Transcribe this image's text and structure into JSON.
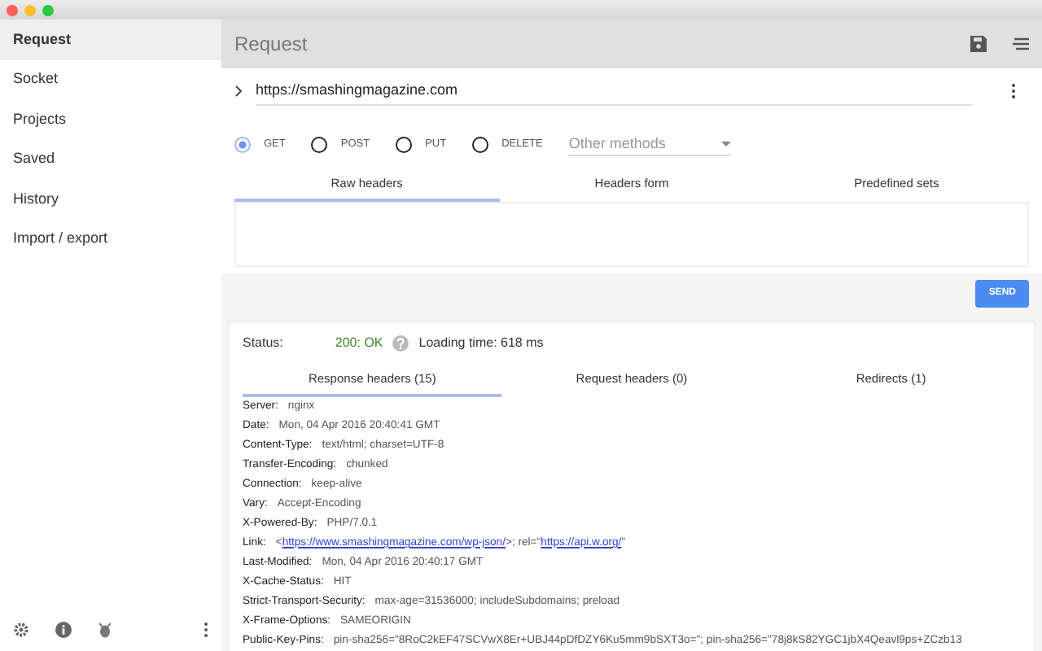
{
  "sidebar": {
    "items": [
      {
        "label": "Request",
        "selected": true
      },
      {
        "label": "Socket",
        "selected": false
      },
      {
        "label": "Projects",
        "selected": false
      },
      {
        "label": "Saved",
        "selected": false
      },
      {
        "label": "History",
        "selected": false
      },
      {
        "label": "Import / export",
        "selected": false
      }
    ]
  },
  "header": {
    "title": "Request"
  },
  "request": {
    "url": "https://smashingmagazine.com",
    "methods": [
      {
        "label": "GET",
        "selected": true
      },
      {
        "label": "POST",
        "selected": false
      },
      {
        "label": "PUT",
        "selected": false
      },
      {
        "label": "DELETE",
        "selected": false
      }
    ],
    "other_methods": {
      "placeholder": "Other methods"
    },
    "tabs": [
      {
        "label": "Raw headers",
        "selected": true
      },
      {
        "label": "Headers form",
        "selected": false
      },
      {
        "label": "Predefined sets",
        "selected": false
      }
    ],
    "send_button": "SEND"
  },
  "response": {
    "status_label": "Status:",
    "status": "200: OK",
    "loading_time": "Loading time: 618 ms",
    "tabs": [
      {
        "label": "Response headers (15)",
        "selected": true
      },
      {
        "label": "Request headers (0)",
        "selected": false
      },
      {
        "label": "Redirects (1)",
        "selected": false
      }
    ],
    "headers": [
      {
        "name": "Server:",
        "value": [
          {
            "kind": "text",
            "text": "nginx"
          }
        ]
      },
      {
        "name": "Date:",
        "value": [
          {
            "kind": "text",
            "text": "Mon, 04 Apr 2016 20:40:41 GMT"
          }
        ]
      },
      {
        "name": "Content-Type:",
        "value": [
          {
            "kind": "text",
            "text": "text/html; charset=UTF-8"
          }
        ]
      },
      {
        "name": "Transfer-Encoding:",
        "value": [
          {
            "kind": "text",
            "text": "chunked"
          }
        ]
      },
      {
        "name": "Connection:",
        "value": [
          {
            "kind": "text",
            "text": "keep-alive"
          }
        ]
      },
      {
        "name": "Vary:",
        "value": [
          {
            "kind": "text",
            "text": "Accept-Encoding"
          }
        ]
      },
      {
        "name": "X-Powered-By:",
        "value": [
          {
            "kind": "text",
            "text": "PHP/7.0.1"
          }
        ]
      },
      {
        "name": "Link:",
        "value": [
          {
            "kind": "text",
            "text": "<"
          },
          {
            "kind": "link",
            "text": "https://www.smashingmagazine.com/wp-json/"
          },
          {
            "kind": "text",
            "text": ">; rel=\""
          },
          {
            "kind": "link",
            "text": "https://api.w.org/"
          },
          {
            "kind": "text",
            "text": "\""
          }
        ]
      },
      {
        "name": "Last-Modified:",
        "value": [
          {
            "kind": "text",
            "text": "Mon, 04 Apr 2016 20:40:17 GMT"
          }
        ]
      },
      {
        "name": "X-Cache-Status:",
        "value": [
          {
            "kind": "text",
            "text": "HIT"
          }
        ]
      },
      {
        "name": "Strict-Transport-Security:",
        "value": [
          {
            "kind": "text",
            "text": "max-age=31536000; includeSubdomains; preload"
          }
        ]
      },
      {
        "name": "X-Frame-Options:",
        "value": [
          {
            "kind": "text",
            "text": "SAMEORIGIN"
          }
        ]
      },
      {
        "name": "Public-Key-Pins:",
        "value": [
          {
            "kind": "text",
            "text": "pin-sha256=\"8RoC2kEF47SCVwX8Er+UBJ44pDfDZY6Ku5mm9bSXT3o=\"; pin-sha256=\"78j8kS82YGC1jbX4Qeavl9ps+ZCzb13"
          }
        ]
      }
    ]
  }
}
